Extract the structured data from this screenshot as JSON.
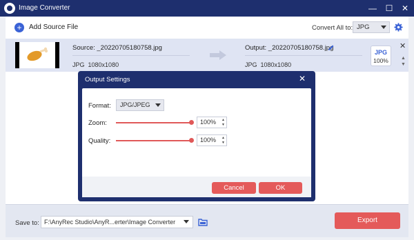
{
  "window": {
    "title": "Image Converter",
    "controls": {
      "minimize": "—",
      "maximize": "☐",
      "close": "✕"
    }
  },
  "toolbar": {
    "add_source_label": "Add Source File",
    "add_icon": "+",
    "convert_all_label": "Convert All to:",
    "convert_all_value": "JPG"
  },
  "file_item": {
    "source_name": "Source: _20220705180758.jpg",
    "source_format": "JPG",
    "source_size": "1080x1080",
    "output_name": "Output: _20220705180758.jpg",
    "output_format": "JPG",
    "output_size": "1080x1080",
    "badge_format": "JPG",
    "badge_zoom": "100%",
    "close_glyph": "✕",
    "collapse_glyph": "▲",
    "expand_glyph": "▼"
  },
  "dialog": {
    "title": "Output Settings",
    "close_glyph": "✕",
    "format_label": "Format:",
    "format_value": "JPG/JPEG",
    "zoom_label": "Zoom:",
    "zoom_value": "100%",
    "zoom_level": 1.0,
    "quality_label": "Quality:",
    "quality_value": "100%",
    "quality_level": 1.0,
    "stepper_up": "▲",
    "stepper_down": "▼",
    "cancel_label": "Cancel",
    "ok_label": "OK"
  },
  "bottom": {
    "save_to_label": "Save to:",
    "save_path": "F:\\AnyRec Studio\\AnyR...erter\\Image Converter",
    "export_label": "Export"
  },
  "colors": {
    "titlebar": "#1e2f6e",
    "accent_blue": "#3b63d6",
    "accent_red": "#e45a5a"
  }
}
